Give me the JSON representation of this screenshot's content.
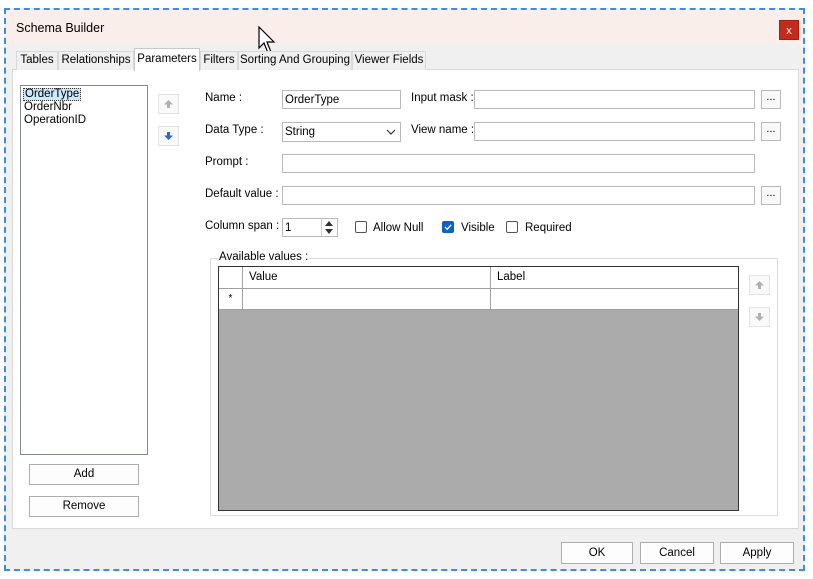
{
  "window": {
    "title": "Schema Builder",
    "close_label": "x"
  },
  "tabs": [
    {
      "label": "Tables"
    },
    {
      "label": "Relationships"
    },
    {
      "label": "Parameters"
    },
    {
      "label": "Filters"
    },
    {
      "label": "Sorting And Grouping"
    },
    {
      "label": "Viewer Fields"
    }
  ],
  "parameters": {
    "items": [
      {
        "label": "OrderType",
        "selected": true
      },
      {
        "label": "OrderNbr"
      },
      {
        "label": "OperationID"
      }
    ],
    "add_label": "Add",
    "remove_label": "Remove"
  },
  "form": {
    "name_label": "Name :",
    "name_value": "OrderType",
    "input_mask_label": "Input mask :",
    "input_mask_value": "",
    "data_type_label": "Data Type :",
    "data_type_value": "String",
    "view_name_label": "View name :",
    "view_name_value": "",
    "prompt_label": "Prompt :",
    "prompt_value": "",
    "default_value_label": "Default value :",
    "default_value_value": "",
    "column_span_label": "Column span :",
    "column_span_value": "1",
    "allow_null_label": "Allow Null",
    "allow_null_checked": false,
    "visible_label": "Visible",
    "visible_checked": true,
    "required_label": "Required",
    "required_checked": false,
    "browse_label": "..."
  },
  "available_values": {
    "title": "Available values :",
    "columns": [
      "Value",
      "Label"
    ],
    "new_row_marker": "*"
  },
  "footer": {
    "ok_label": "OK",
    "cancel_label": "Cancel",
    "apply_label": "Apply"
  }
}
